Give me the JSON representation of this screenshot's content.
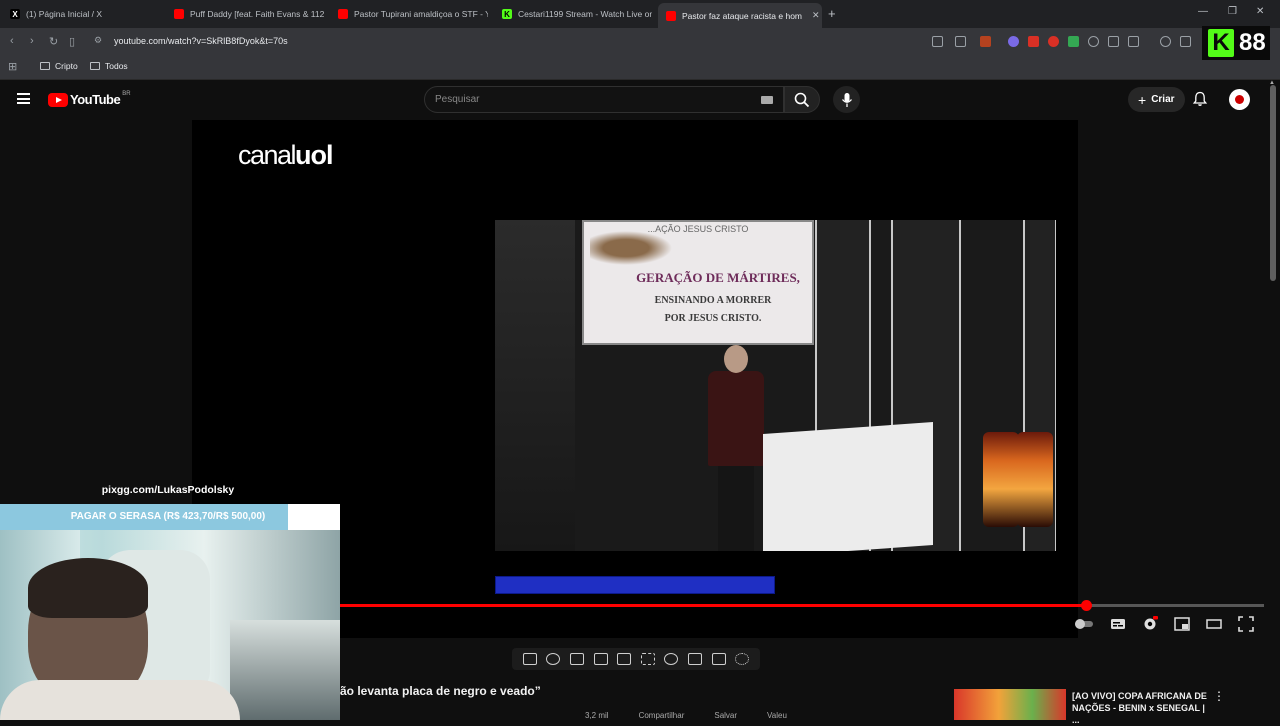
{
  "browser": {
    "tabs": [
      {
        "label": "(1) Página Inicial / X",
        "favicon": "X",
        "color": "#000000"
      },
      {
        "label": "Puff Daddy [feat. Faith Evans & 112]",
        "favicon": "yt",
        "color": "#ff0000"
      },
      {
        "label": "Pastor Tupirani amaldiçoa o STF - Yo",
        "favicon": "yt",
        "color": "#ff0000"
      },
      {
        "label": "Cestari1199 Stream - Watch Live on",
        "favicon": "K",
        "color": "#53fc18"
      },
      {
        "label": "Pastor faz ataque racista e hom",
        "favicon": "yt",
        "color": "#ff0000",
        "active": true
      }
    ],
    "new_tab": "+",
    "url": "youtube.com/watch?v=SkRlB8fDyok&t=70s",
    "bookmarks": [
      "Cripto",
      "Todos"
    ],
    "kick_badge": {
      "letter": "K",
      "number": "88"
    }
  },
  "youtube": {
    "logo_text": "YouTube",
    "country_code": "BR",
    "search_placeholder": "Pesquisar",
    "create_label": "Criar",
    "video_title_partial": "ão levanta placa de negro e veado”",
    "below_actions": [
      "3,2 mil",
      "Compartilhar",
      "Salvar",
      "Valeu"
    ],
    "recommended": {
      "title": "[AO VIVO] COPA AFRICANA DE NAÇÕES - BENIN x SENEGAL | ..."
    },
    "progress_fraction": 0.805
  },
  "video_frame": {
    "channel_logo_a": "canal",
    "channel_logo_b": "uol",
    "banner_top": "...AÇÃO JESUS CRISTO",
    "banner_line1": "GERAÇÃO DE MÁRTIRES,",
    "banner_line2": "ENSINANDO A MORRER",
    "banner_line3": "POR JESUS CRISTO."
  },
  "stream_overlay": {
    "pix_url": "pixgg.com/LukasPodolsky",
    "goal_text": "PAGAR O SERASA (R$ 423,70/R$ 500,00)",
    "goal_fraction": 0.8474
  }
}
